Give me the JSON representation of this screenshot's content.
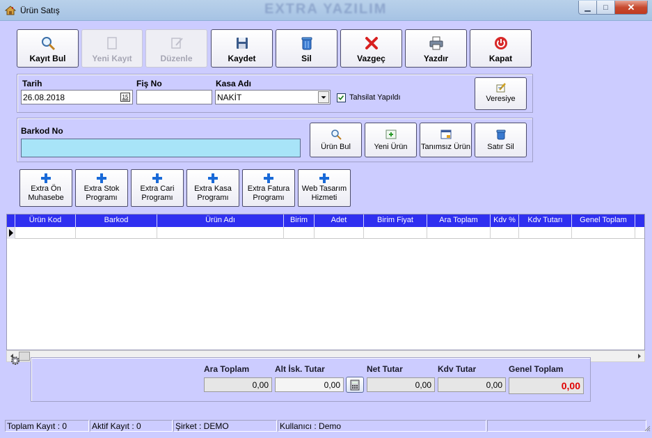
{
  "window": {
    "title": "Ürün Satış",
    "watermark": "EXTRA YAZILIM",
    "min_glyph": "▁",
    "max_glyph": "□",
    "close_glyph": "✕"
  },
  "toolbar": {
    "kayit_bul": "Kayıt Bul",
    "yeni_kayit": "Yeni Kayıt",
    "duzenle": "Düzenle",
    "kaydet": "Kaydet",
    "sil": "Sil",
    "vazgec": "Vazgeç",
    "yazdir": "Yazdır",
    "kapat": "Kapat"
  },
  "header": {
    "tarih_label": "Tarih",
    "tarih_value": "26.08.2018",
    "fis_no_label": "Fiş No",
    "fis_no_value": "",
    "kasa_adi_label": "Kasa Adı",
    "kasa_adi_value": "NAKİT",
    "tahsilat_label": "Tahsilat Yapıldı",
    "tahsilat_checked": true,
    "veresiye": "Veresiye",
    "calendar_glyph": "15"
  },
  "barkod": {
    "label": "Barkod No",
    "value": "",
    "urun_bul": "Ürün Bul",
    "yeni_urun": "Yeni Ürün",
    "tanimsiz_urun": "Tanımsız Ürün",
    "satir_sil": "Satır Sil"
  },
  "extra_buttons": [
    "Extra Ön Muhasebe",
    "Extra Stok Programı",
    "Extra Cari Programı",
    "Extra Kasa Programı",
    "Extra Fatura Programı",
    "Web Tasarım Hizmeti"
  ],
  "grid": {
    "columns": [
      "Ürün Kod",
      "Barkod",
      "Ürün Adı",
      "Birim",
      "Adet",
      "Birim Fiyat",
      "Ara Toplam",
      "Kdv %",
      "Kdv Tutarı",
      "Genel Toplam"
    ],
    "rows": []
  },
  "totals": {
    "ara_toplam_label": "Ara Toplam",
    "ara_toplam": "0,00",
    "alt_isk_label": "Alt İsk. Tutar",
    "alt_isk": "0,00",
    "net_tutar_label": "Net Tutar",
    "net_tutar": "0,00",
    "kdv_tutar_label": "Kdv Tutar",
    "kdv_tutar": "0,00",
    "genel_toplam_label": "Genel Toplam",
    "genel_toplam": "0,00"
  },
  "status": {
    "toplam_kayit": "Toplam Kayıt : 0",
    "aktif_kayit": "Aktif Kayıt : 0",
    "sirket": "Şirket : DEMO",
    "kullanici": "Kullanıcı : Demo"
  },
  "colors": {
    "client_bg": "#ccccff",
    "grid_header": "#2f2ff0",
    "barkod_input": "#a8e4f8",
    "genel_toplam_text": "#e00000"
  }
}
